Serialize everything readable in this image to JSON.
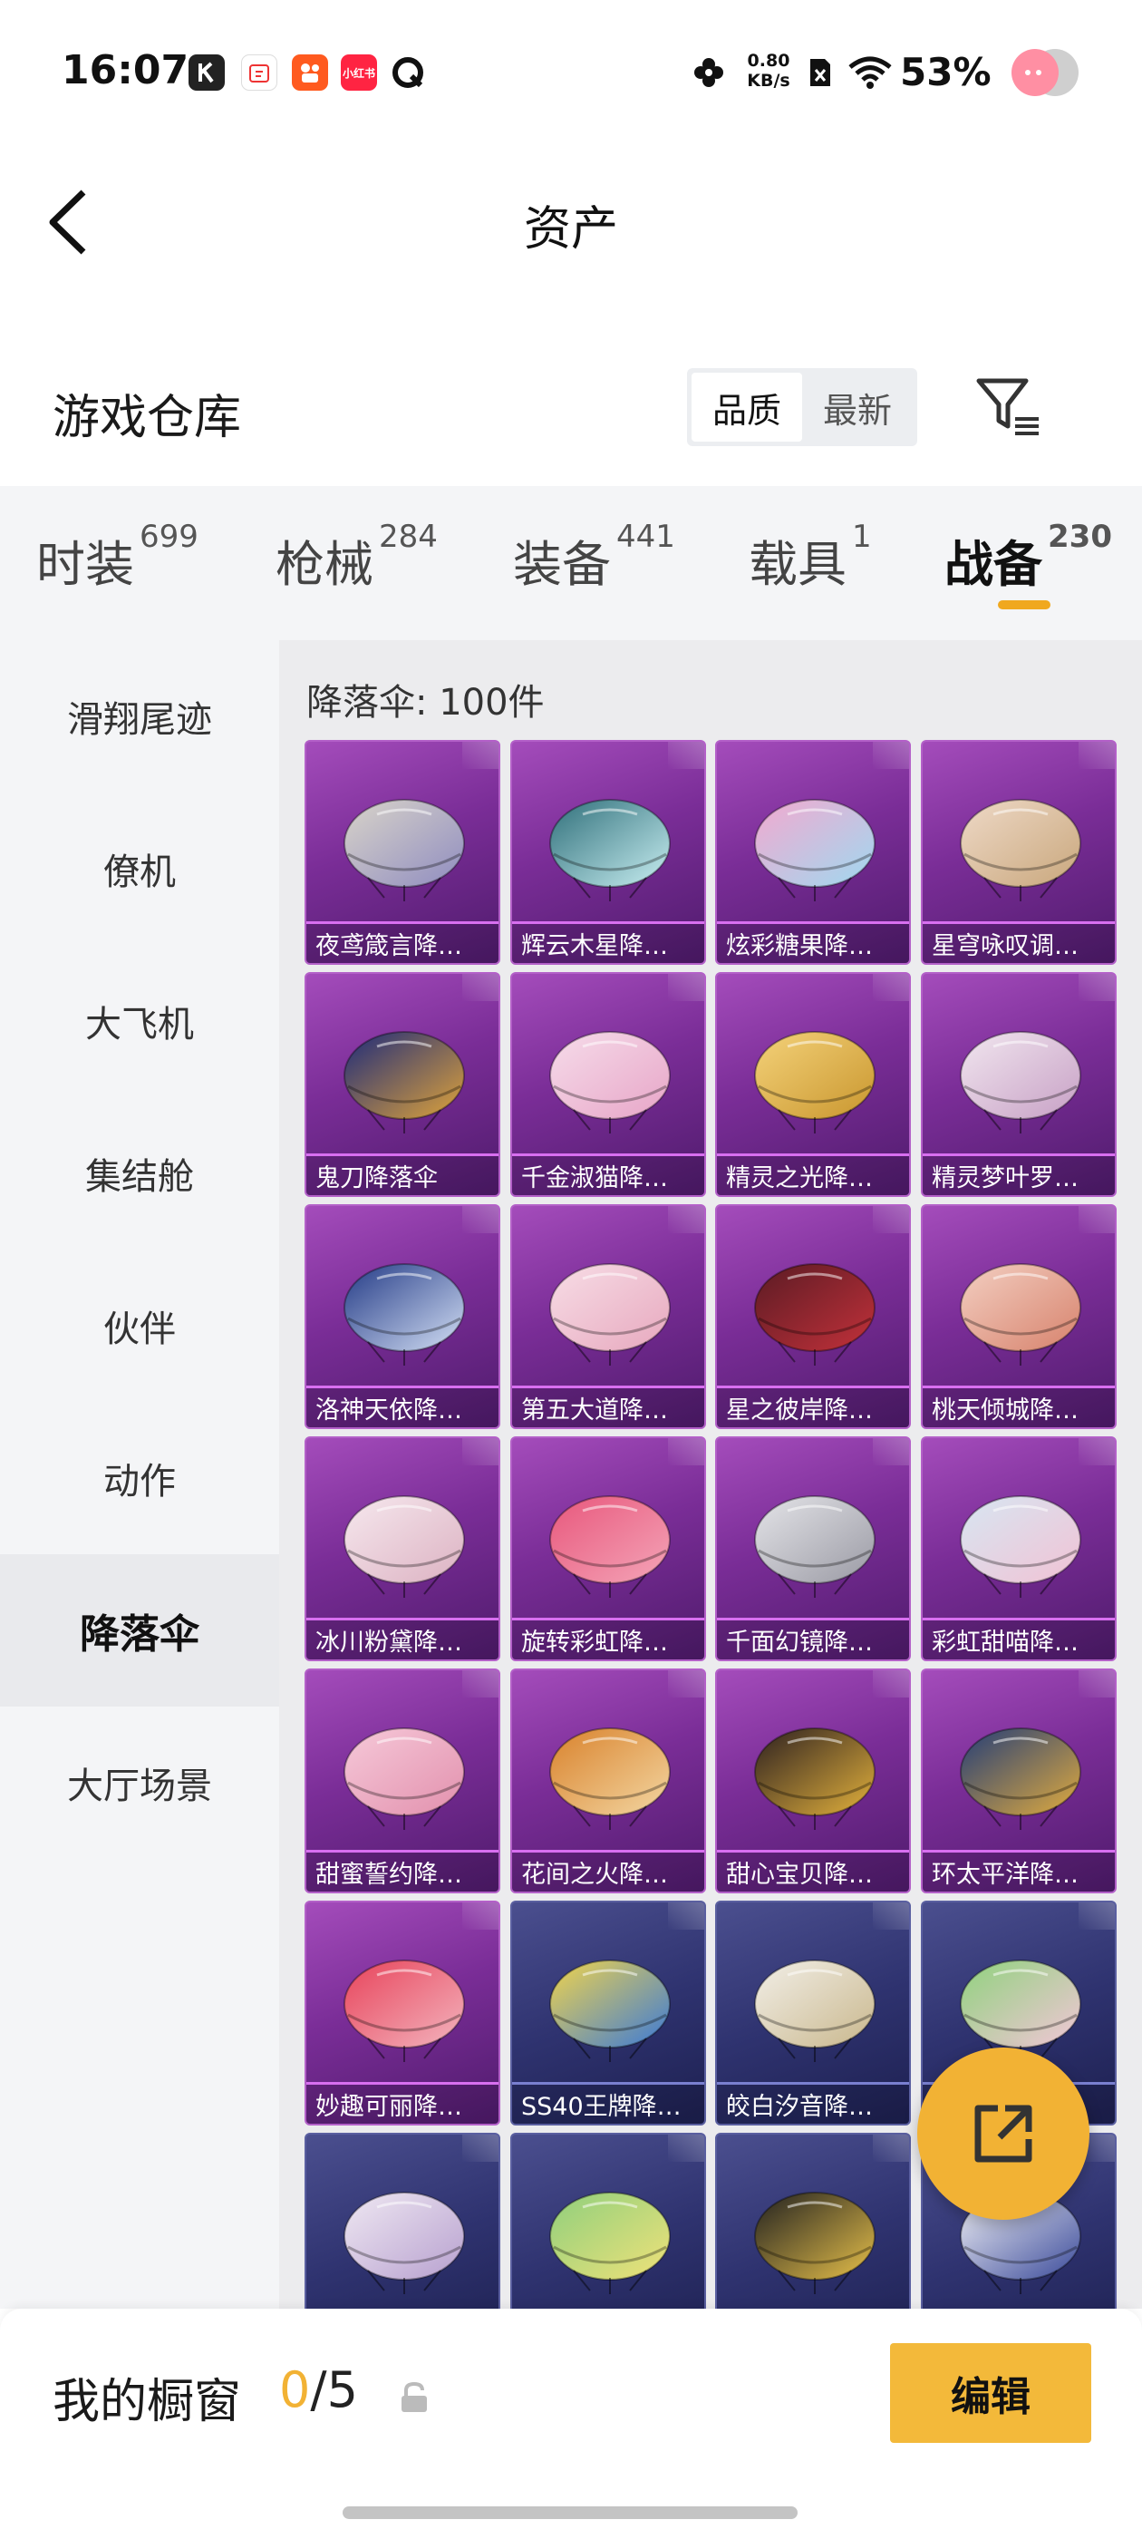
{
  "status_bar": {
    "time": "16:07",
    "net_speed_value": "0.80",
    "net_speed_unit": "KB/s",
    "battery": "53%",
    "app_icons": [
      "k-icon",
      "calendar-icon",
      "kuaishou-icon",
      "xiaohongshu-icon",
      "q-icon"
    ],
    "xiaohongshu_text": "小红书"
  },
  "header": {
    "title": "资产"
  },
  "warehouse": {
    "title": "游戏仓库",
    "sort_options": [
      "品质",
      "最新"
    ],
    "sort_selected": "品质"
  },
  "tabs": [
    {
      "label": "时装",
      "count": "699"
    },
    {
      "label": "枪械",
      "count": "284"
    },
    {
      "label": "装备",
      "count": "441"
    },
    {
      "label": "载具",
      "count": "1"
    },
    {
      "label": "战备",
      "count": "230"
    }
  ],
  "active_tab": "战备",
  "sidebar": {
    "items": [
      "滑翔尾迹",
      "僚机",
      "大飞机",
      "集结舱",
      "伙伴",
      "动作",
      "降落伞",
      "大厅场景"
    ],
    "active": "降落伞"
  },
  "content": {
    "count_text": "降落伞: 100件",
    "items": [
      {
        "name": "夜鸢箴言降…",
        "rarity": "purple",
        "colors": [
          "#d9d4c9",
          "#8f8cc0"
        ]
      },
      {
        "name": "辉云木星降…",
        "rarity": "purple",
        "colors": [
          "#2f6f7a",
          "#c9eff2"
        ]
      },
      {
        "name": "炫彩糖果降…",
        "rarity": "purple",
        "colors": [
          "#f3a9cf",
          "#9fd9f0"
        ]
      },
      {
        "name": "星穹咏叹调…",
        "rarity": "purple",
        "colors": [
          "#eed9c7",
          "#c9a77c"
        ]
      },
      {
        "name": "鬼刀降落伞",
        "rarity": "purple",
        "colors": [
          "#1d2a7a",
          "#e0a43a"
        ]
      },
      {
        "name": "千金淑猫降…",
        "rarity": "purple",
        "colors": [
          "#f6dcea",
          "#e7a5c7"
        ]
      },
      {
        "name": "精灵之光降…",
        "rarity": "purple",
        "colors": [
          "#f4d27a",
          "#c9962e"
        ]
      },
      {
        "name": "精灵梦叶罗…",
        "rarity": "purple",
        "colors": [
          "#f1e6ef",
          "#c7a0c5"
        ]
      },
      {
        "name": "洛神天依降…",
        "rarity": "purple",
        "colors": [
          "#233a86",
          "#d4e0f5"
        ]
      },
      {
        "name": "第五大道降…",
        "rarity": "purple",
        "colors": [
          "#f7dde6",
          "#e7a8be"
        ]
      },
      {
        "name": "星之彼岸降…",
        "rarity": "purple",
        "colors": [
          "#5a1b24",
          "#c3313a"
        ]
      },
      {
        "name": "桃天倾城降…",
        "rarity": "purple",
        "colors": [
          "#f3cfc2",
          "#d7826c"
        ]
      },
      {
        "name": "冰川粉黛降…",
        "rarity": "purple",
        "colors": [
          "#f6e8ee",
          "#dcb2c2"
        ]
      },
      {
        "name": "旋转彩虹降…",
        "rarity": "purple",
        "colors": [
          "#e8577c",
          "#f4a5b8"
        ]
      },
      {
        "name": "千面幻镜降…",
        "rarity": "purple",
        "colors": [
          "#e4e4e8",
          "#9a9aa4"
        ]
      },
      {
        "name": "彩虹甜喵降…",
        "rarity": "purple",
        "colors": [
          "#d7e6f2",
          "#f1c2d4"
        ]
      },
      {
        "name": "甜蜜誓约降…",
        "rarity": "purple",
        "colors": [
          "#f6c9d9",
          "#e290ad"
        ]
      },
      {
        "name": "花间之火降…",
        "rarity": "purple",
        "colors": [
          "#d9822c",
          "#f3d7a3"
        ]
      },
      {
        "name": "甜心宝贝降…",
        "rarity": "purple",
        "colors": [
          "#2c2020",
          "#e4b23c"
        ]
      },
      {
        "name": "环太平洋降…",
        "rarity": "purple",
        "colors": [
          "#233d77",
          "#e2ac3e"
        ]
      },
      {
        "name": "妙趣可丽降…",
        "rarity": "purple",
        "colors": [
          "#e8435a",
          "#f3b5bf"
        ]
      },
      {
        "name": "SS40王牌降…",
        "rarity": "blue",
        "colors": [
          "#f2d54b",
          "#3a79d8"
        ]
      },
      {
        "name": "皎白汐音降…",
        "rarity": "blue",
        "colors": [
          "#f2efe8",
          "#c9b78c"
        ]
      },
      {
        "name": "",
        "rarity": "blue",
        "colors": [
          "#8fd27d",
          "#f3c6d8"
        ]
      },
      {
        "name": "",
        "rarity": "blue",
        "colors": [
          "#efe8f2",
          "#b7a0cf"
        ]
      },
      {
        "name": "",
        "rarity": "blue",
        "colors": [
          "#8fcf7c",
          "#f0e27a"
        ]
      },
      {
        "name": "",
        "rarity": "blue",
        "colors": [
          "#202020",
          "#e8c14a"
        ]
      },
      {
        "name": "",
        "rarity": "blue",
        "colors": [
          "#f2f2f6",
          "#3a4a9a"
        ]
      }
    ]
  },
  "showcase": {
    "label": "我的橱窗",
    "current": "0",
    "separator": "/",
    "max": "5",
    "edit_label": "编辑"
  }
}
